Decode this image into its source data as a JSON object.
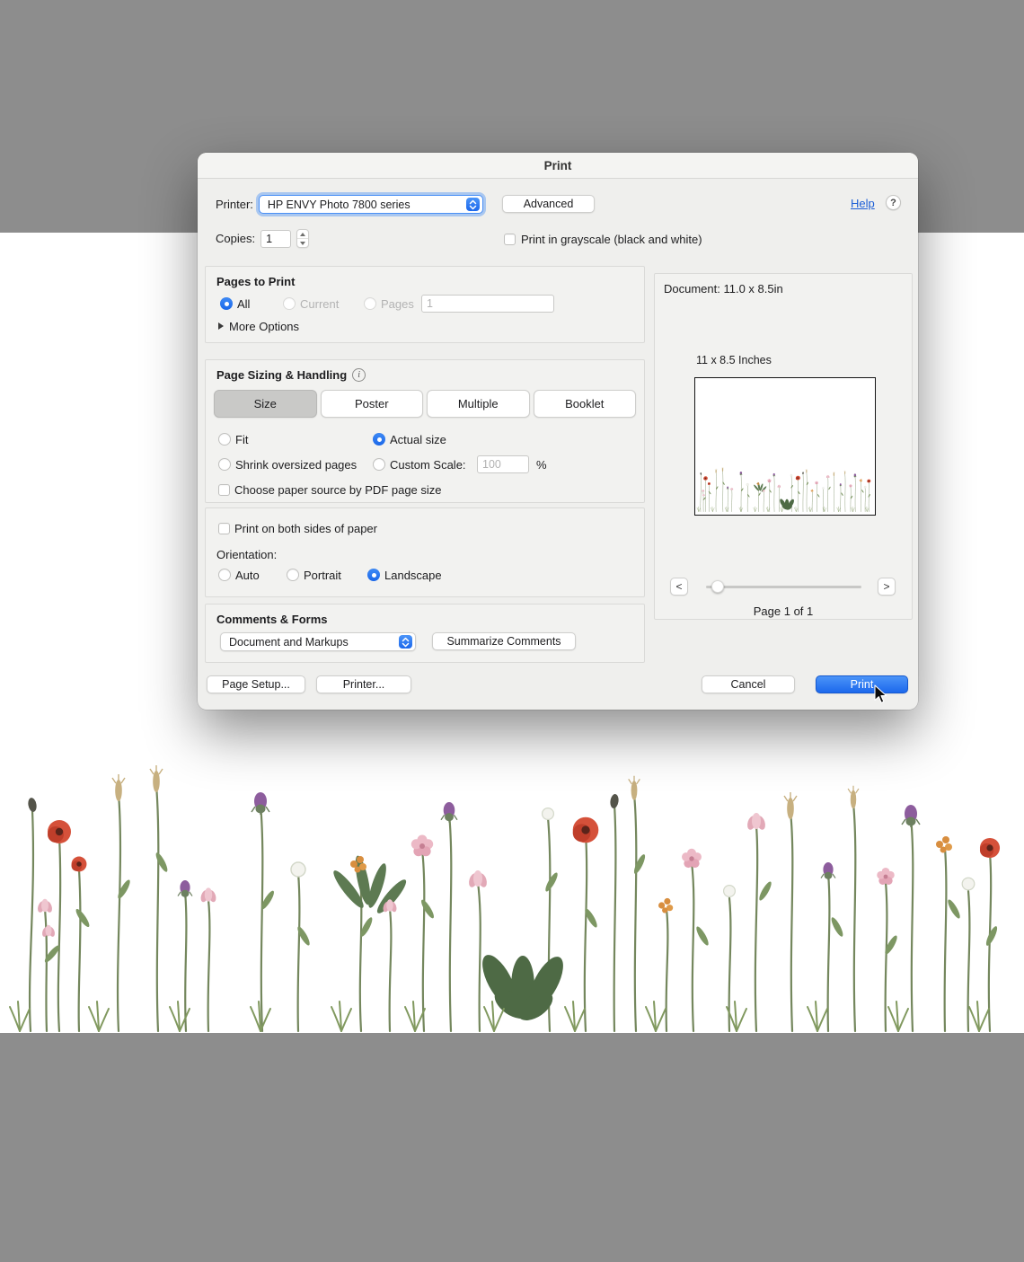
{
  "window": {
    "title": "Print"
  },
  "printer_row": {
    "label": "Printer:",
    "value": "HP ENVY Photo 7800 series",
    "advanced": "Advanced",
    "help": "Help",
    "help_icon": "?"
  },
  "copies_row": {
    "label": "Copies:",
    "value": "1",
    "grayscale": "Print in grayscale (black and white)"
  },
  "pages_to_print": {
    "title": "Pages to Print",
    "all": "All",
    "current": "Current",
    "pages": "Pages",
    "pages_value": "1",
    "more_options": "More Options"
  },
  "page_sizing": {
    "title": "Page Sizing & Handling",
    "info_icon": "i",
    "tabs": [
      "Size",
      "Poster",
      "Multiple",
      "Booklet"
    ],
    "selected_tab": "Size",
    "fit": "Fit",
    "actual_size": "Actual size",
    "shrink": "Shrink oversized pages",
    "custom_scale": "Custom Scale:",
    "custom_scale_value": "100",
    "percent": "%",
    "paper_source": "Choose paper source by PDF page size"
  },
  "duplex": {
    "both_sides": "Print on both sides of paper",
    "orientation": "Orientation:",
    "auto": "Auto",
    "portrait": "Portrait",
    "landscape": "Landscape"
  },
  "comments": {
    "title": "Comments & Forms",
    "value": "Document and Markups",
    "summarize": "Summarize Comments"
  },
  "footer": {
    "page_setup": "Page Setup...",
    "printer": "Printer...",
    "cancel": "Cancel",
    "print": "Print"
  },
  "preview": {
    "document_info": "Document: 11.0 x 8.5in",
    "size_label": "11 x 8.5 Inches",
    "page_indicator": "Page 1 of 1",
    "prev": "<",
    "next": ">"
  },
  "colors": {
    "accent_blue": "#1c68ec",
    "desktop_gray": "#8d8d8d"
  }
}
